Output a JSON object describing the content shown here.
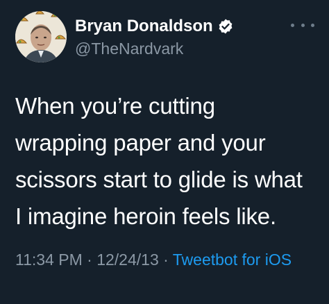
{
  "author": {
    "display_name": "Bryan Donaldson",
    "handle": "@TheNardvark",
    "verified": true
  },
  "tweet": {
    "lines": [
      "When you’re cutting",
      "wrapping paper and your",
      "scissors start to glide is what",
      "I imagine heroin feels like."
    ]
  },
  "meta": {
    "time": "11:34 PM",
    "separator": " · ",
    "date": "12/24/13",
    "source": "Tweetbot for iOS"
  },
  "icons": {
    "more": "more-options-icon",
    "verified": "verified-badge-icon"
  },
  "colors": {
    "background": "#15202b",
    "text": "#ffffff",
    "secondary_text": "#8b98a5",
    "link": "#1d9bf0"
  }
}
